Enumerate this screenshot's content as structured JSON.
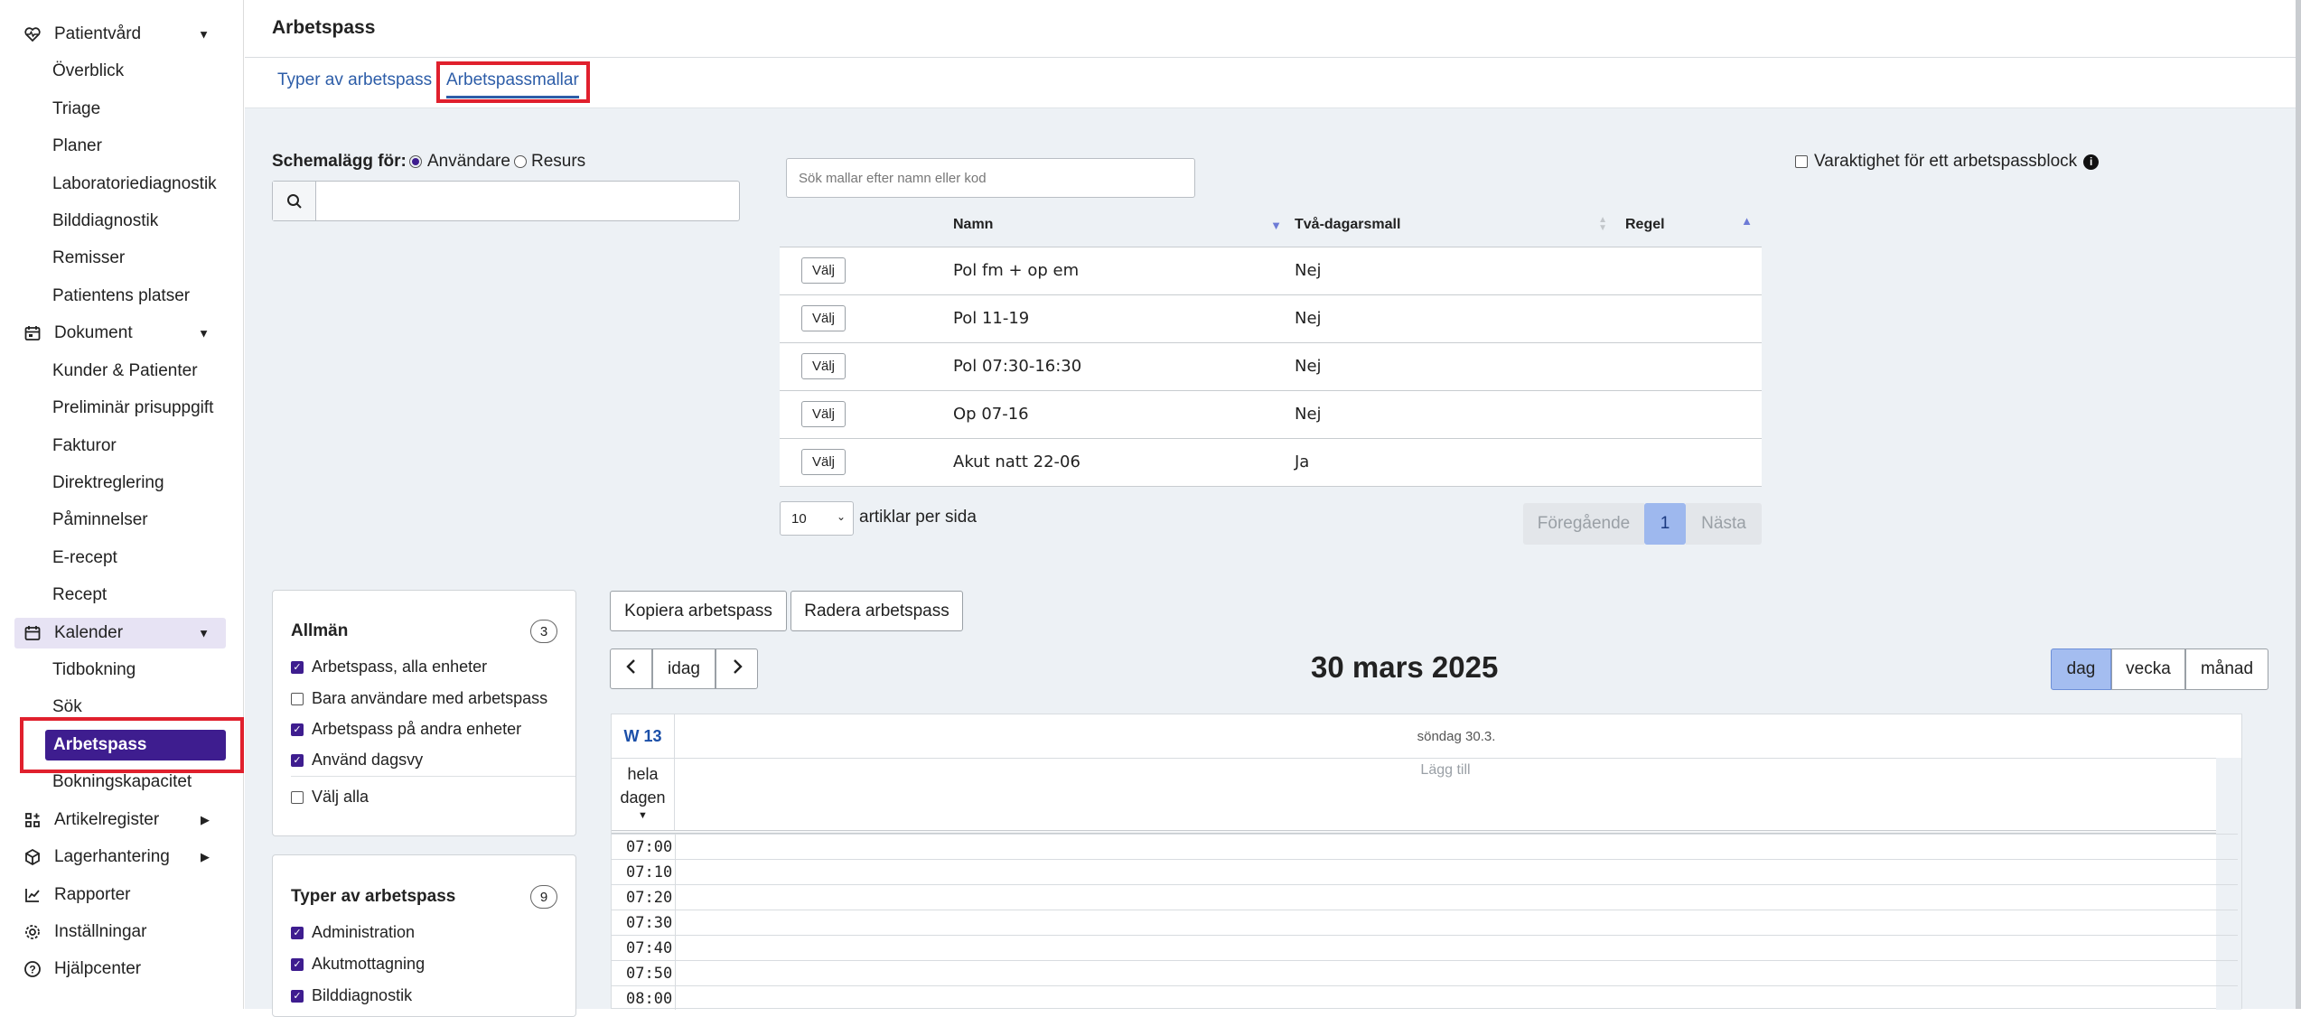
{
  "sidebar": {
    "patientvard": "Patientvård",
    "overblick": "Överblick",
    "triage": "Triage",
    "planer": "Planer",
    "laboratoriediagnostik": "Laboratoriediagnostik",
    "bilddiagnostik": "Bilddiagnostik",
    "remisser": "Remisser",
    "patientens_platser": "Patientens platser",
    "dokument": "Dokument",
    "kunder_patienter": "Kunder & Patienter",
    "preliminar_prisuppgift": "Preliminär prisuppgift",
    "fakturor": "Fakturor",
    "direktreglering": "Direktreglering",
    "paminnelser": "Påminnelser",
    "e_recept": "E-recept",
    "recept": "Recept",
    "kalender": "Kalender",
    "tidbokning": "Tidbokning",
    "sok": "Sök",
    "arbetspass": "Arbetspass",
    "bokningskapacitet": "Bokningskapacitet",
    "artikelregister": "Artikelregister",
    "lagerhantering": "Lagerhantering",
    "rapporter": "Rapporter",
    "installningar": "Inställningar",
    "hjalpcenter": "Hjälpcenter"
  },
  "header": {
    "title": "Arbetspass"
  },
  "tabs": {
    "types": "Typer av arbetspass",
    "templates": "Arbetspassmallar"
  },
  "schedule": {
    "label": "Schemalägg för:",
    "opt_user": "Användare",
    "opt_resource": "Resurs"
  },
  "search": {
    "placeholder": "Sök mallar efter namn eller kod"
  },
  "duration": {
    "label": "Varaktighet för ett arbetspassblock"
  },
  "table": {
    "col_name": "Namn",
    "col_twoday": "Två-dagarsmall",
    "col_rule": "Regel",
    "select_label": "Välj",
    "rows": [
      {
        "name": "Pol fm + op em",
        "twoday": "Nej"
      },
      {
        "name": "Pol 11-19",
        "twoday": "Nej"
      },
      {
        "name": "Pol 07:30-16:30",
        "twoday": "Nej"
      },
      {
        "name": "Op 07-16",
        "twoday": "Nej"
      },
      {
        "name": "Akut natt 22-06",
        "twoday": "Ja"
      }
    ]
  },
  "pagination": {
    "per_page": "10",
    "per_page_label": "artiklar per sida",
    "prev": "Föregående",
    "page": "1",
    "next": "Nästa"
  },
  "filters": {
    "general": {
      "title": "Allmän",
      "count": "3",
      "items": [
        "Arbetspass, alla enheter",
        "Bara användare med arbetspass",
        "Arbetspass på andra enheter",
        "Använd dagsvy"
      ],
      "checked": [
        true,
        false,
        true,
        true
      ],
      "select_all": "Välj alla"
    },
    "types": {
      "title": "Typer av arbetspass",
      "count": "9",
      "items": [
        "Administration",
        "Akutmottagning",
        "Bilddiagnostik"
      ]
    }
  },
  "actions": {
    "copy": "Kopiera arbetspass",
    "delete": "Radera arbetspass"
  },
  "calendar": {
    "today": "idag",
    "date_title": "30 mars 2025",
    "view_day": "dag",
    "view_week": "vecka",
    "view_month": "månad",
    "week": "W 13",
    "day_header": "söndag 30.3.",
    "allday_1": "hela",
    "allday_2": "dagen",
    "add": "Lägg till",
    "times": [
      "07:00",
      "07:10",
      "07:20",
      "07:30",
      "07:40",
      "07:50",
      "08:00"
    ]
  }
}
